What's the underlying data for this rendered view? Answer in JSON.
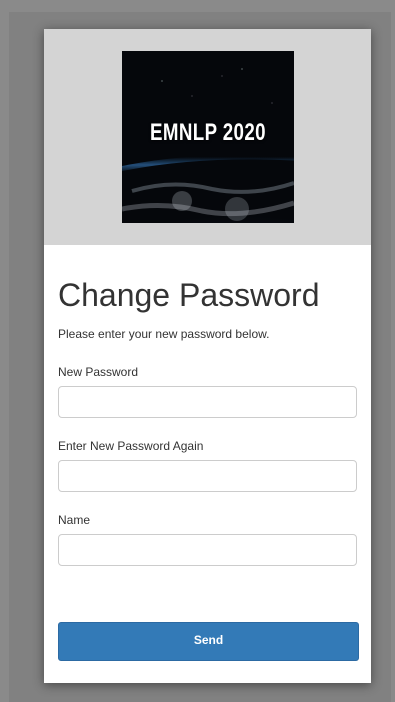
{
  "logo": {
    "text": "EMNLP 2020",
    "icon": "earth-night-image"
  },
  "form": {
    "title": "Change Password",
    "subtitle": "Please enter your new password below.",
    "new_password_label": "New Password",
    "new_password_value": "",
    "confirm_password_label": "Enter New Password Again",
    "confirm_password_value": "",
    "name_label": "Name",
    "name_value": "",
    "send_label": "Send"
  },
  "colors": {
    "primary_button": "#337ab7",
    "banner_background": "#d4d4d4",
    "page_background": "#8a8a8a"
  }
}
